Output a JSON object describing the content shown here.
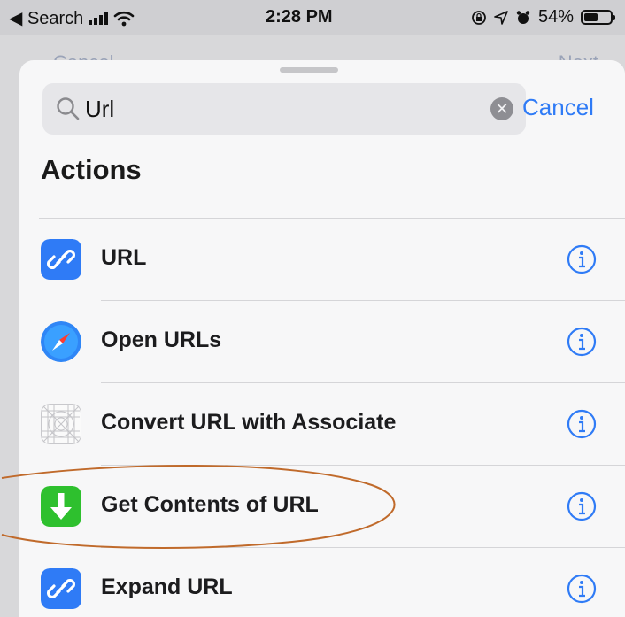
{
  "status_bar": {
    "back_label": "◀ Search",
    "time": "2:28 PM",
    "battery_percent": "54%",
    "battery_level": 0.54
  },
  "behind": {
    "left_label": "Cancel",
    "right_label": "Next"
  },
  "search": {
    "query": "Url",
    "cancel_label": "Cancel"
  },
  "section_title": "Actions",
  "actions": [
    {
      "label": "URL",
      "icon": "link-icon"
    },
    {
      "label": "Open URLs",
      "icon": "safari-compass-icon"
    },
    {
      "label": "Convert URL with Associate",
      "icon": "app-grid-icon"
    },
    {
      "label": "Get Contents of URL",
      "icon": "download-arrow-icon"
    },
    {
      "label": "Expand URL",
      "icon": "link-icon"
    }
  ],
  "colors": {
    "accent": "#2f7bf6",
    "highlight_ellipse": "#c06a2b",
    "download_green": "#2ec02e"
  }
}
